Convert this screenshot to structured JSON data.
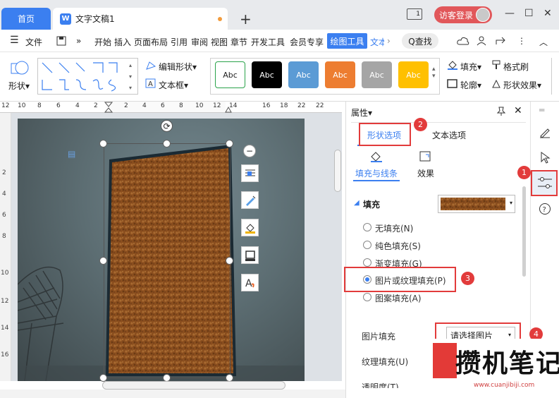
{
  "titlebar": {
    "home_tab": "首页",
    "doc_icon": "W",
    "doc_tab": "文字文稿1",
    "new_tab": "+",
    "pages_icon_text": "1",
    "login_label": "访客登录",
    "win_minimize": "—",
    "win_maximize": "☐",
    "win_close": "✕"
  },
  "menubar": {
    "hamburger": "☰",
    "file": "文件",
    "more": "»",
    "items": [
      "开始",
      "插入",
      "页面布局",
      "引用",
      "审阅",
      "视图",
      "章节",
      "开发工具",
      "会员专享"
    ],
    "active": "绘图工具",
    "cut_item": "文本",
    "search": "Q查找"
  },
  "ribbon": {
    "shape_label": "形状▾",
    "edit_shape": "编辑形状▾",
    "text_box": "文本框▾",
    "style_buttons": [
      {
        "label": "Abc",
        "bg": "#ffffff",
        "fg": "#222222",
        "border": "#2aa34a"
      },
      {
        "label": "Abc",
        "bg": "#000000",
        "fg": "#ffffff",
        "border": "#000000"
      },
      {
        "label": "Abc",
        "bg": "#5b9bd5",
        "fg": "#ffffff",
        "border": "#5b9bd5"
      },
      {
        "label": "Abc",
        "bg": "#ed7d31",
        "fg": "#ffffff",
        "border": "#ed7d31"
      },
      {
        "label": "Abc",
        "bg": "#a5a5a5",
        "fg": "#ffffff",
        "border": "#a5a5a5"
      },
      {
        "label": "Abc",
        "bg": "#ffc000",
        "fg": "#ffffff",
        "border": "#ffc000"
      }
    ],
    "fill": "填充▾",
    "format_painter": "格式刷",
    "outline": "轮廓▾",
    "shape_effects": "形状效果▾"
  },
  "ruler": {
    "h_ticks": [
      "12",
      "10",
      "8",
      "6",
      "4",
      "2",
      "2",
      "4",
      "6",
      "8",
      "10",
      "12",
      "14",
      "16",
      "18",
      "22"
    ],
    "v_ticks": [
      "2",
      "4",
      "6",
      "8",
      "10",
      "12",
      "14",
      "16"
    ]
  },
  "panel": {
    "title": "属性▾",
    "tab_shape": "形状选项",
    "tab_text": "文本选项",
    "sub_fill_line": "填充与线条",
    "sub_effect": "效果",
    "fill_heading": "填充",
    "options": [
      {
        "label": "无填充(N)",
        "selected": false
      },
      {
        "label": "纯色填充(S)",
        "selected": false
      },
      {
        "label": "渐变填充(G)",
        "selected": false
      },
      {
        "label": "图片或纹理填充(P)",
        "selected": true
      },
      {
        "label": "图案填充(A)",
        "selected": false
      }
    ],
    "picture_fill_label": "图片填充",
    "picture_fill_value": "请选择图片",
    "texture_fill_label": "纹理填充(U)",
    "transparency_label": "透明度(T)"
  },
  "badges": [
    "1",
    "2",
    "3",
    "4"
  ],
  "colors": {
    "accent": "#3b7ff0",
    "annotation_red": "#e23b3b",
    "leather": "#8a4e1e"
  },
  "watermark": {
    "text": "攒机笔记",
    "url": "www.cuanjibiji.com"
  }
}
